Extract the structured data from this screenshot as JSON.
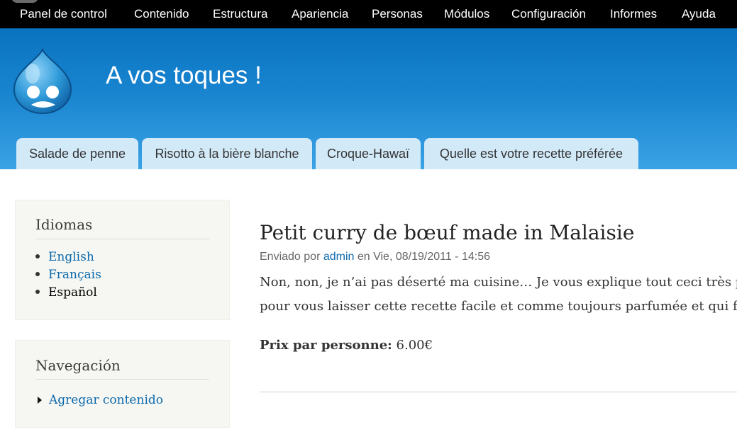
{
  "toolbar": {
    "items": [
      "Panel de control",
      "Contenido",
      "Estructura",
      "Apariencia",
      "Personas",
      "Módulos",
      "Configuración",
      "Informes",
      "Ayuda"
    ]
  },
  "header": {
    "site_name": "A vos toques !",
    "logo_icon": "drupal-drop-logo",
    "tabs": [
      "Salade de penne",
      "Risotto à la bière blanche",
      "Croque-Hawaï",
      "Quelle est votre recette préférée"
    ]
  },
  "sidebar": {
    "languages": {
      "title": "Idiomas",
      "items": [
        "English",
        "Français",
        "Español"
      ],
      "active": "Español"
    },
    "navigation": {
      "title": "Navegación",
      "items": [
        "Agregar contenido"
      ]
    }
  },
  "node": {
    "title": "Petit curry de bœuf made in Malaisie",
    "submitted_prefix": "Enviado por",
    "author": "admin",
    "submitted_suffix": "en Vie, 08/19/2011 - 14:56",
    "body_lines": [
      "Non, non, je n’ai pas déserté ma cuisine… Je vous explique tout ceci très pro",
      "pour vous laisser cette recette facile et comme toujours parfumée et qui fait"
    ],
    "price_label": "Prix par personne:",
    "price_value": "6.00€"
  },
  "colors": {
    "toolbar_bg": "#000000",
    "header_top": "#0a73c0",
    "header_bottom": "#3aa2e5",
    "tab_bg": "#d2e9f8",
    "link": "#0b6aad",
    "sidebar_bg": "#f6f6f2"
  }
}
